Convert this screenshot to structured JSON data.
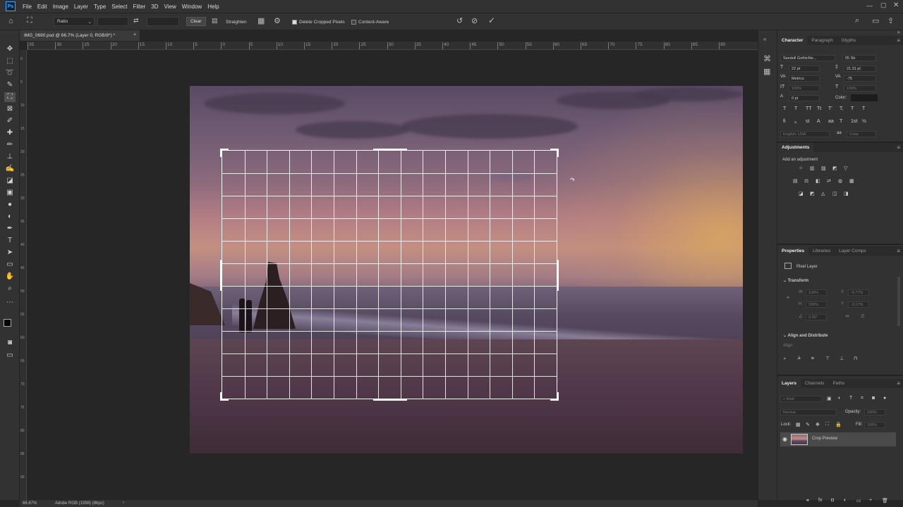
{
  "menu": [
    "File",
    "Edit",
    "Image",
    "Layer",
    "Type",
    "Select",
    "Filter",
    "3D",
    "View",
    "Window",
    "Help"
  ],
  "options": {
    "ratio_label": "Ratio",
    "clear_label": "Clear",
    "straighten_label": "Straighten",
    "delete_cropped_label": "Delete Cropped Pixels",
    "content_aware_label": "Content-Aware"
  },
  "document_tab": {
    "title": "IMG_0690.psd @ 66.7% (Layer 0, RGB/8*) *",
    "close": "×"
  },
  "ruler_top": [
    "35",
    "30",
    "25",
    "20",
    "15",
    "10",
    "5",
    "0",
    "5",
    "10",
    "15",
    "20",
    "25",
    "30",
    "35",
    "40",
    "45",
    "50",
    "55",
    "60",
    "65",
    "70",
    "75",
    "80",
    "85",
    "90"
  ],
  "ruler_left": [
    "0",
    "5",
    "10",
    "15",
    "20",
    "25",
    "30",
    "35",
    "40",
    "45",
    "50",
    "55",
    "60",
    "65",
    "70",
    "75",
    "80",
    "85",
    "90"
  ],
  "character": {
    "tabs": [
      "Character",
      "Paragraph",
      "Glyphs"
    ],
    "font_family": "Sandoll GothicNe...",
    "font_style": "05 Sb",
    "font_size": "22 pt",
    "leading": "21.31 pt",
    "kerning": "Metrics",
    "tracking": "-75",
    "vscale": "100%",
    "hscale": "100%",
    "baseline": "0 pt",
    "color_label": "Color:",
    "style_buttons": [
      "T",
      "T",
      "TT",
      "Tt",
      "T'",
      "T,",
      "T",
      "T"
    ],
    "ot_buttons": [
      "fi",
      "ℴ",
      "st",
      "A",
      "aa",
      "T",
      "1st",
      "½"
    ],
    "language": "English: USA",
    "aa_label": "aa",
    "aa_method": "Crisp"
  },
  "adjustments": {
    "title": "Adjustments",
    "subtitle": "Add an adjustment"
  },
  "properties": {
    "tabs": [
      "Properties",
      "Libraries",
      "Layer Comps"
    ],
    "layer_kind": "Pixel Layer",
    "transform_label": "Transform",
    "w_label": "W",
    "w_value": "100%",
    "h_label": "H",
    "h_value": "100%",
    "x_label": "X",
    "x_value": "-5.77%",
    "y_label": "Y",
    "y_value": "-3.17%",
    "angle_value": "0.00°",
    "align_label": "Align and Distribute",
    "align_sub": "Align:"
  },
  "layers": {
    "tabs": [
      "Layers",
      "Channels",
      "Paths"
    ],
    "filter_placeholder": "Kind",
    "blend_mode": "Normal",
    "opacity_label": "Opacity:",
    "opacity_value": "100%",
    "lock_label": "Lock:",
    "fill_label": "Fill:",
    "fill_value": "100%",
    "layer_name": "Crop Preview"
  },
  "status": {
    "zoom": "66.67%",
    "profile": "Adobe RGB (1998) (8bpc)",
    "arrow": "›"
  }
}
